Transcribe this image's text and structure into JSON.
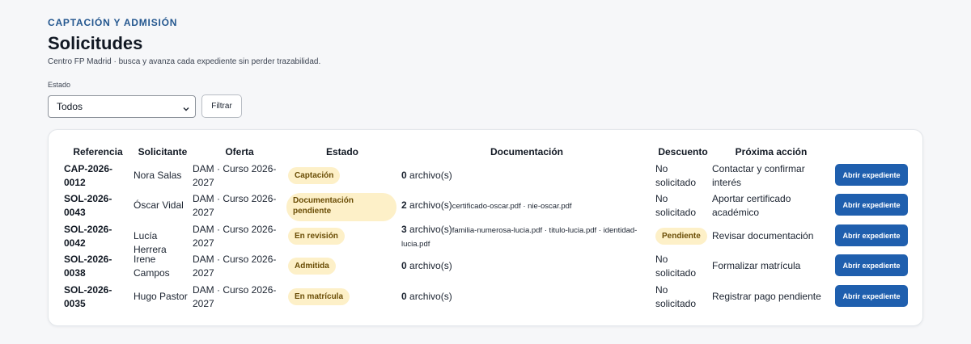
{
  "header": {
    "eyebrow": "CAPTACIÓN Y ADMISIÓN",
    "title": "Solicitudes",
    "subtitle": "Centro FP Madrid · busca y avanza cada expediente sin perder trazabilidad."
  },
  "filter": {
    "label": "Estado",
    "selected": "Todos",
    "button": "Filtrar"
  },
  "table": {
    "headers": {
      "referencia": "Referencia",
      "solicitante": "Solicitante",
      "oferta": "Oferta",
      "estado": "Estado",
      "documentacion": "Documentación",
      "descuento": "Descuento",
      "proxima": "Próxima acción"
    },
    "rows": [
      {
        "ref1": "CAP-2026-",
        "ref2": "0012",
        "solicitante1": "Nora Salas",
        "solicitante2": "",
        "oferta1": "DAM · Curso 2026-",
        "oferta2": "2027",
        "estado1": "Captación",
        "estado2": "",
        "doc_count": "0",
        "doc_unit": " archivo(s)",
        "doc_files": "",
        "doc_files2": "",
        "descuento1": "No",
        "descuento2": "solicitado",
        "descuento_badge": "",
        "accion1": "Contactar y confirmar",
        "accion2": "interés",
        "boton": "Abrir expediente"
      },
      {
        "ref1": "SOL-2026-",
        "ref2": "0043",
        "solicitante1": "Óscar Vidal",
        "solicitante2": "",
        "oferta1": "DAM · Curso 2026-",
        "oferta2": "2027",
        "estado1": "Documentación",
        "estado2": "pendiente",
        "doc_count": "2",
        "doc_unit": " archivo(s)",
        "doc_files": "certificado-oscar.pdf · nie-oscar.pdf",
        "doc_files2": "",
        "descuento1": "No",
        "descuento2": "solicitado",
        "descuento_badge": "",
        "accion1": "Aportar certificado",
        "accion2": "académico",
        "boton": "Abrir expediente"
      },
      {
        "ref1": "SOL-2026-",
        "ref2": "0042",
        "solicitante1": "Lucía Herrera",
        "solicitante2": "",
        "oferta1": "DAM · Curso 2026-",
        "oferta2": "2027",
        "estado1": "En revisión",
        "estado2": "",
        "doc_count": "3",
        "doc_unit": " archivo(s)",
        "doc_files": "familia-numerosa-lucia.pdf · titulo-lucia.pdf · identidad-",
        "doc_files2": "lucia.pdf",
        "descuento1": "",
        "descuento2": "",
        "descuento_badge": "Pendiente",
        "accion1": "Revisar documentación",
        "accion2": "",
        "boton": "Abrir expediente"
      },
      {
        "ref1": "SOL-2026-",
        "ref2": "0038",
        "solicitante1": "Irene",
        "solicitante2": "Campos",
        "oferta1": "DAM · Curso 2026-",
        "oferta2": "2027",
        "estado1": "Admitida",
        "estado2": "",
        "doc_count": "0",
        "doc_unit": " archivo(s)",
        "doc_files": "",
        "doc_files2": "",
        "descuento1": "No",
        "descuento2": "solicitado",
        "descuento_badge": "",
        "accion1": "Formalizar matrícula",
        "accion2": "",
        "boton": "Abrir expediente"
      },
      {
        "ref1": "SOL-2026-",
        "ref2": "0035",
        "solicitante1": "Hugo Pastor",
        "solicitante2": "",
        "oferta1": "DAM · Curso 2026-",
        "oferta2": "2027",
        "estado1": "En matrícula",
        "estado2": "",
        "doc_count": "0",
        "doc_unit": " archivo(s)",
        "doc_files": "",
        "doc_files2": "",
        "descuento1": "No",
        "descuento2": "solicitado",
        "descuento_badge": "",
        "accion1": "Registrar pago pendiente",
        "accion2": "",
        "boton": "Abrir expediente"
      }
    ]
  },
  "colors": {
    "accent": "#24578f",
    "button": "#1f5fae",
    "badge_bg": "#fdf0c8",
    "badge_text": "#6a4d06"
  },
  "icons": {
    "select_arrow": "chevron-down-icon"
  }
}
